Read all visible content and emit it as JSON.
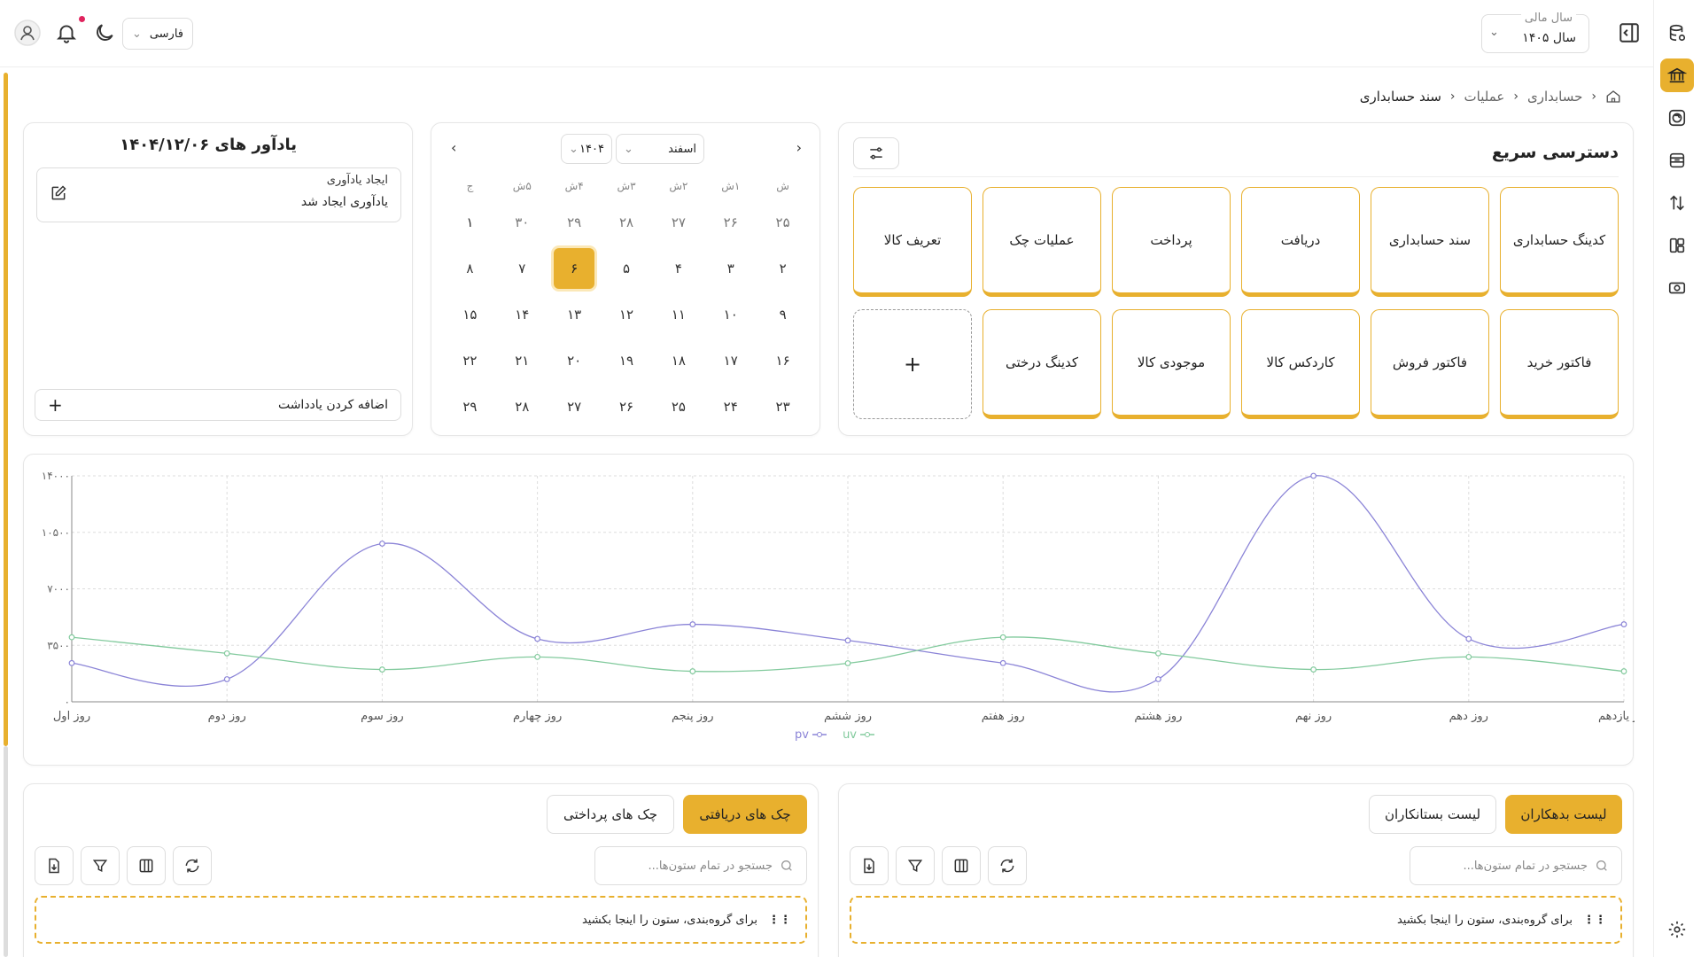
{
  "topbar": {
    "fiscal_year_label": "سال مالی",
    "fiscal_year_value": "سال ۱۴۰۵",
    "language": "فارسی"
  },
  "breadcrumb": [
    "حسابداری",
    "عملیات",
    "سند حسابداری"
  ],
  "quick_access": {
    "title": "دسترسی سریع",
    "tiles_row1": [
      "کدینگ حسابداری",
      "سند حسابداری",
      "دریافت",
      "پرداخت",
      "عملیات چک",
      "تعریف کالا"
    ],
    "tiles_row2": [
      "فاکتور خرید",
      "فاکتور فروش",
      "کاردکس کالا",
      "موجودی کالا",
      "کدینگ درختی"
    ],
    "add_symbol": "+"
  },
  "calendar": {
    "month": "اسفند",
    "year": "۱۴۰۴",
    "weekdays": [
      "ش",
      "۱ش",
      "۲ش",
      "۳ش",
      "۴ش",
      "۵ش",
      "ج"
    ],
    "rows": [
      [
        "۲۵",
        "۲۶",
        "۲۷",
        "۲۸",
        "۲۹",
        "۳۰",
        "۱"
      ],
      [
        "۲",
        "۳",
        "۴",
        "۵",
        "۶",
        "۷",
        "۸"
      ],
      [
        "۹",
        "۱۰",
        "۱۱",
        "۱۲",
        "۱۳",
        "۱۴",
        "۱۵"
      ],
      [
        "۱۶",
        "۱۷",
        "۱۸",
        "۱۹",
        "۲۰",
        "۲۱",
        "۲۲"
      ],
      [
        "۲۳",
        "۲۴",
        "۲۵",
        "۲۶",
        "۲۷",
        "۲۸",
        "۲۹"
      ]
    ],
    "today": "۶"
  },
  "reminders": {
    "title": "یادآور های ۱۴۰۴/۱۲/۰۶",
    "item_title": "ایجاد یادآوری",
    "item_text": "یادآوری ایجاد شد",
    "add_note": "اضافه کردن یادداشت"
  },
  "chart_data": {
    "type": "line",
    "categories": [
      "روز اول",
      "روز دوم",
      "روز سوم",
      "روز چهارم",
      "روز پنجم",
      "روز ششم",
      "روز هفتم",
      "روز هشتم",
      "روز نهم",
      "روز دهم",
      "روز یازدهم"
    ],
    "y_ticks": [
      "۰",
      "۳۵۰۰",
      "۷۰۰۰",
      "۱۰۵۰۰",
      "۱۴۰۰۰"
    ],
    "ylim": [
      0,
      14000
    ],
    "series": [
      {
        "name": "pv",
        "color": "#8b84d7",
        "values": [
          2400,
          1400,
          9800,
          3900,
          4800,
          3800,
          2400,
          1400,
          14000,
          3900,
          4800
        ]
      },
      {
        "name": "uv",
        "color": "#82ca9d",
        "values": [
          4000,
          3000,
          2000,
          2780,
          1890,
          2390,
          4000,
          3000,
          2000,
          2780,
          1890
        ]
      }
    ],
    "grid": true,
    "legend": "bottom"
  },
  "tables": {
    "right": {
      "tab_active": "لیست بدهکاران",
      "tab_idle": "لیست بستانکاران",
      "search_placeholder": "جستجو در تمام ستون‌ها...",
      "group_hint": "برای گروه‌بندی، ستون را اینجا بکشید"
    },
    "left": {
      "tab_active": "چک های دریافتی",
      "tab_idle": "چک های پرداختی",
      "search_placeholder": "جستجو در تمام ستون‌ها...",
      "group_hint": "برای گروه‌بندی، ستون را اینجا بکشید"
    }
  }
}
